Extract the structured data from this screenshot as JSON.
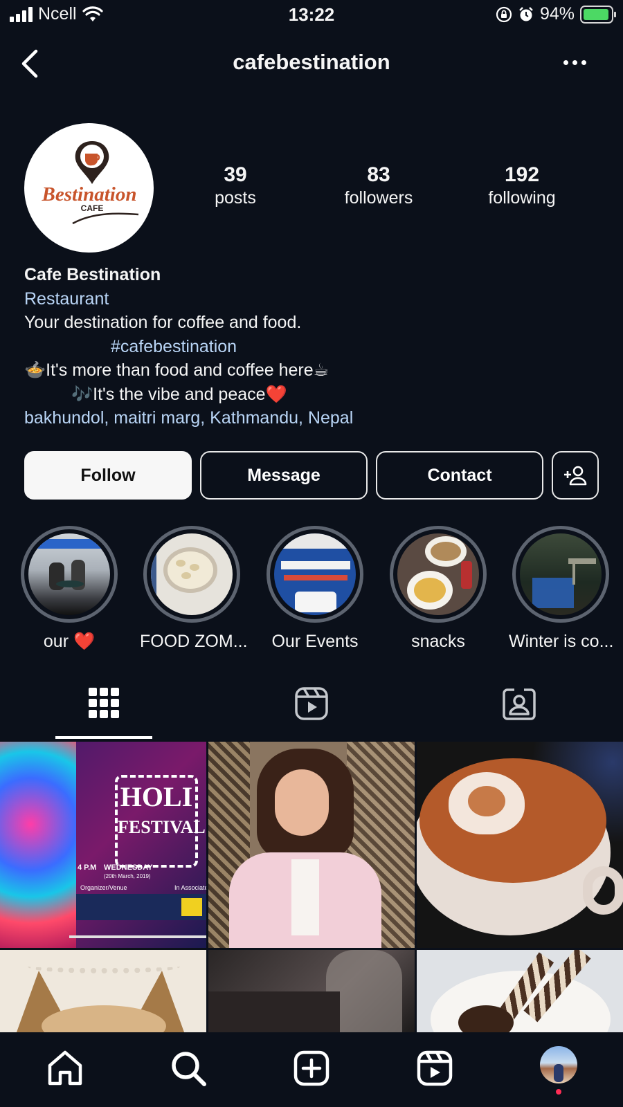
{
  "status_bar": {
    "carrier": "Ncell",
    "time": "13:22",
    "battery": "94%",
    "battery_level": 0.94
  },
  "header": {
    "username": "cafebestination"
  },
  "profile": {
    "logo_text": "Bestination",
    "logo_sub": "CAFE",
    "stats": [
      {
        "value": "39",
        "label": "posts"
      },
      {
        "value": "83",
        "label": "followers"
      },
      {
        "value": "192",
        "label": "following"
      }
    ],
    "name": "Cafe Bestination",
    "category": "Restaurant",
    "bio_line1": "Your destination for coffee and food.",
    "hashtag": "#cafebestination",
    "bio_line3": "It's more than food and coffee here",
    "bio_line4": "It's the vibe and peace",
    "location": "bakhundol, maitri marg, Kathmandu, Nepal"
  },
  "actions": {
    "follow": "Follow",
    "message": "Message",
    "contact": "Contact"
  },
  "highlights": [
    {
      "label": "our ❤️",
      "colors": [
        "#d9d9d9",
        "#6b7a8c"
      ]
    },
    {
      "label": "FOOD ZOM...",
      "colors": [
        "#e8e6e0",
        "#4a5a7a"
      ]
    },
    {
      "label": "Our Events",
      "colors": [
        "#1e4a9a",
        "#f0f0f0"
      ]
    },
    {
      "label": "snacks",
      "colors": [
        "#c9b89a",
        "#3a2a22"
      ]
    },
    {
      "label": "Winter is co...",
      "colors": [
        "#2a3a2a",
        "#1d4fa8"
      ]
    }
  ],
  "posts": [
    {
      "type": "holi",
      "title1": "HOLI",
      "title2": "FESTIVAL",
      "time": "4 P.M",
      "day": "WEDNESDAY",
      "date": "(20th March, 2019)",
      "org": "Organizer/Venue",
      "assoc": "In Associated"
    },
    {
      "type": "portrait"
    },
    {
      "type": "coffee"
    },
    {
      "type": "dog"
    },
    {
      "type": "dark"
    },
    {
      "type": "dessert"
    }
  ]
}
